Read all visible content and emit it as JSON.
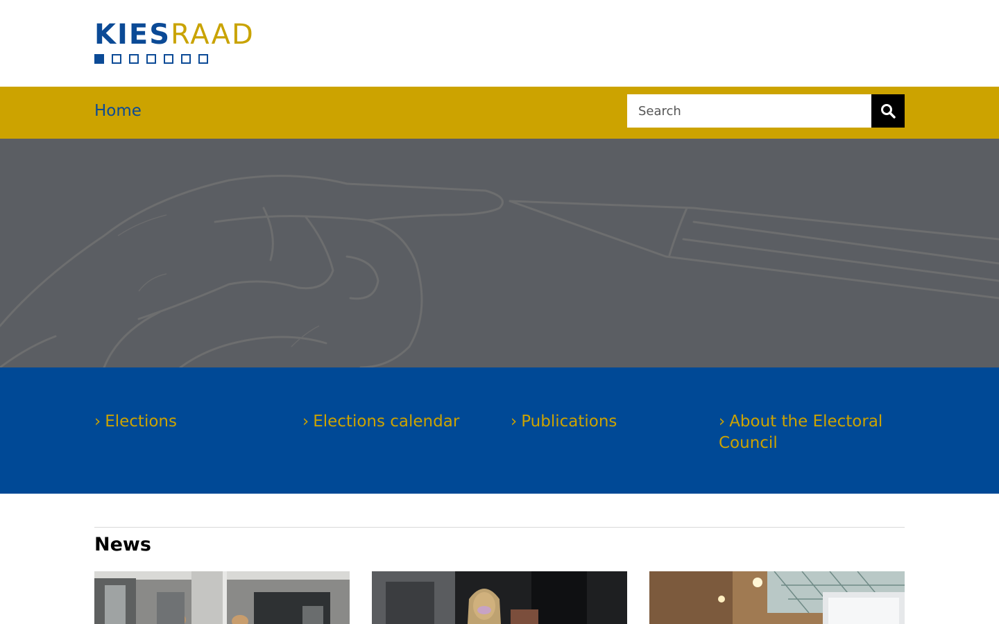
{
  "logo": {
    "part1": "KIES",
    "part2": "RAAD"
  },
  "nav": {
    "home_label": "Home"
  },
  "search": {
    "placeholder": "Search",
    "icon": "search-icon"
  },
  "menu": {
    "items": [
      {
        "label": "Elections"
      },
      {
        "label": "Elections calendar"
      },
      {
        "label": "Publications"
      },
      {
        "label": "About the Electoral Council"
      }
    ]
  },
  "news": {
    "title": "News"
  },
  "colors": {
    "brand_blue": "#004996",
    "brand_gold": "#cca300",
    "hero_gray": "#5b5e63"
  }
}
